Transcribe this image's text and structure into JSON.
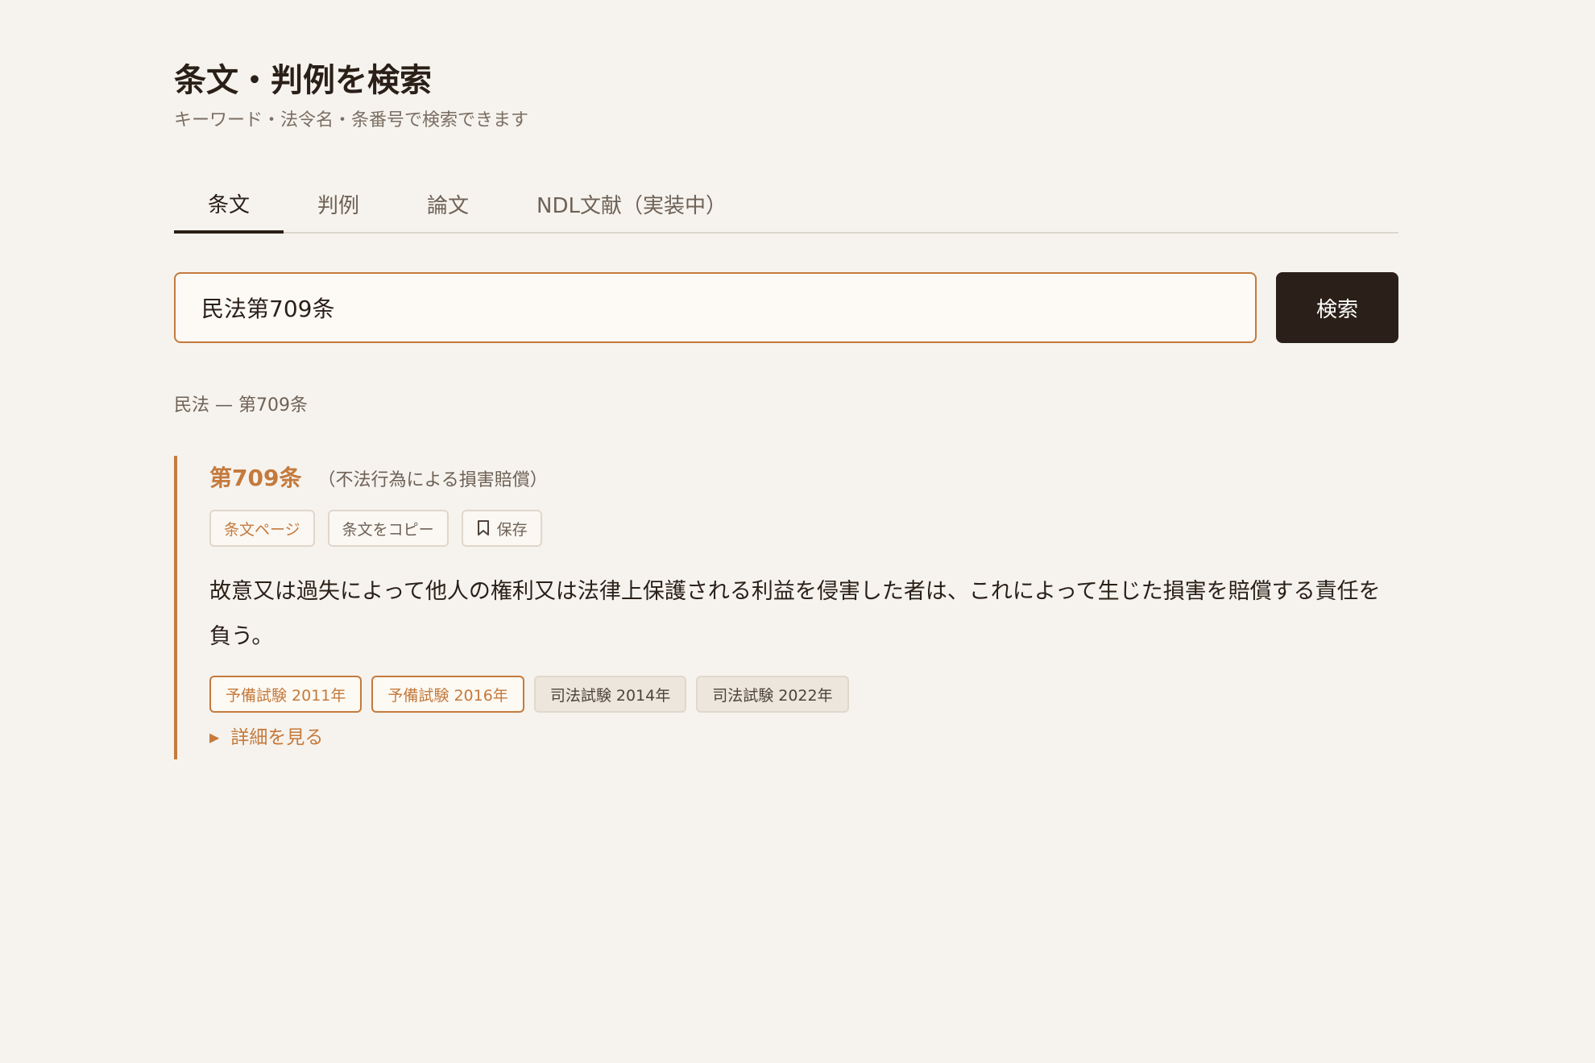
{
  "header": {
    "title": "条文・判例を検索",
    "subtitle": "キーワード・法令名・条番号で検索できます"
  },
  "tabs": [
    {
      "label": "条文",
      "active": true
    },
    {
      "label": "判例",
      "active": false
    },
    {
      "label": "論文",
      "active": false
    },
    {
      "label": "NDL文献（実装中）",
      "active": false
    }
  ],
  "search": {
    "value": "民法第709条",
    "button_label": "検索"
  },
  "result": {
    "breadcrumb": "民法 — 第709条",
    "article": {
      "number": "第709条",
      "caption": "（不法行為による損害賠償）",
      "actions": {
        "page_label": "条文ページ",
        "copy_label": "条文をコピー",
        "save_label": "保存",
        "save_icon": "bookmark-icon"
      },
      "text": "故意又は過失によって他人の権利又は法律上保護される利益を侵害した者は、これによって生じた損害を賠償する責任を負う。",
      "exam_tags": [
        {
          "label": "予備試験 2011年",
          "kind": "prelim"
        },
        {
          "label": "予備試験 2016年",
          "kind": "prelim"
        },
        {
          "label": "司法試験 2014年",
          "kind": "bar"
        },
        {
          "label": "司法試験 2022年",
          "kind": "bar"
        }
      ],
      "details_label": "詳細を見る",
      "details_icon": "triangle-right-icon"
    }
  },
  "colors": {
    "background": "#f6f3ee",
    "accent": "#c47a3d",
    "dark": "#2b2019"
  }
}
